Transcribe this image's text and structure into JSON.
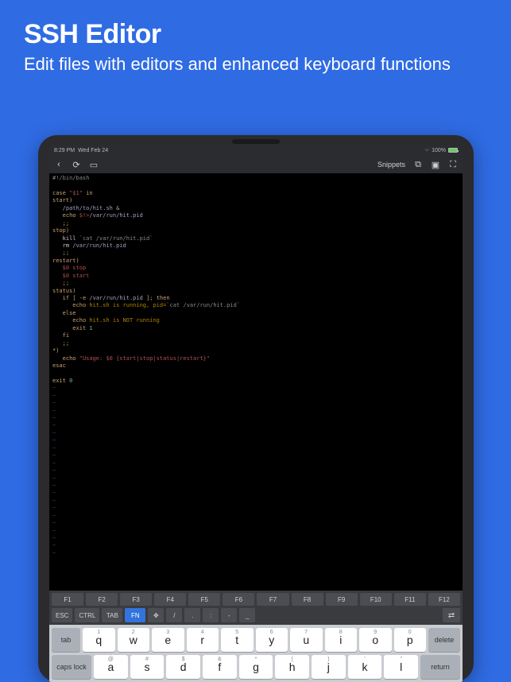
{
  "hero": {
    "title": "SSH Editor",
    "subtitle": "Edit files with editors and enhanced keyboard functions"
  },
  "statusbar": {
    "time": "8:29 PM",
    "date": "Wed Feb 24",
    "battery": "100%"
  },
  "toolbar": {
    "snippets": "Snippets"
  },
  "code": {
    "shebang": "#!/bin/bash",
    "case": "case",
    "case_var": "\"$1\"",
    "in": "in",
    "start": "start",
    "start_path": "/path/to/hit.sh",
    "amp": "&",
    "echo": "echo",
    "pid_var": "$!>",
    "pid_path": "/var/run/hit.pid",
    "sep": ";;",
    "stop": "stop",
    "kill": "kill",
    "cat_cmd": "`cat /var/run/hit.pid`",
    "rm": "rm",
    "rm_path": "/var/run/hit.pid",
    "restart": "restart",
    "self_stop": "$0 stop",
    "self_start": "$0 start",
    "status": "status",
    "if": "if",
    "test": "[ -e",
    "test_path": "/var/run/hit.pid",
    "test_end": "];",
    "then": "then",
    "running_msg": "hit.sh is running, pid=",
    "cat2": "`cat /var/run/hit.pid`",
    "else": "else",
    "notrunning": "hit.sh is NOT running",
    "exit1": "exit",
    "one": "1",
    "fi": "fi",
    "default": "*)",
    "usage": "\"Usage: $0 {start|stop|status|restart}\"",
    "esac": "esac",
    "exit0": "exit",
    "zero": "0"
  },
  "fn_keys": [
    "F1",
    "F2",
    "F3",
    "F4",
    "F5",
    "F6",
    "F7",
    "F8",
    "F9",
    "F10",
    "F11",
    "F12"
  ],
  "ctrl_keys": {
    "esc": "ESC",
    "ctrl": "CTRL",
    "tab": "TAB",
    "fn": "FN",
    "slash": "/",
    "dot": ".",
    "colon": ":",
    "dash": "-",
    "under": "_"
  },
  "keyboard": {
    "tab": "tab",
    "delete": "delete",
    "caps": "caps lock",
    "return": "return",
    "row1": [
      {
        "main": "q",
        "alt": "1"
      },
      {
        "main": "w",
        "alt": "2"
      },
      {
        "main": "e",
        "alt": "3"
      },
      {
        "main": "r",
        "alt": "4"
      },
      {
        "main": "t",
        "alt": "5"
      },
      {
        "main": "y",
        "alt": "6"
      },
      {
        "main": "u",
        "alt": "7"
      },
      {
        "main": "i",
        "alt": "8"
      },
      {
        "main": "o",
        "alt": "9"
      },
      {
        "main": "p",
        "alt": "0"
      }
    ],
    "row2": [
      {
        "main": "a",
        "alt": "@"
      },
      {
        "main": "s",
        "alt": "#"
      },
      {
        "main": "d",
        "alt": "$"
      },
      {
        "main": "f",
        "alt": "&"
      },
      {
        "main": "g",
        "alt": "*"
      },
      {
        "main": "h",
        "alt": "("
      },
      {
        "main": "j",
        "alt": ")"
      },
      {
        "main": "k",
        "alt": "'"
      },
      {
        "main": "l",
        "alt": "\""
      }
    ]
  }
}
